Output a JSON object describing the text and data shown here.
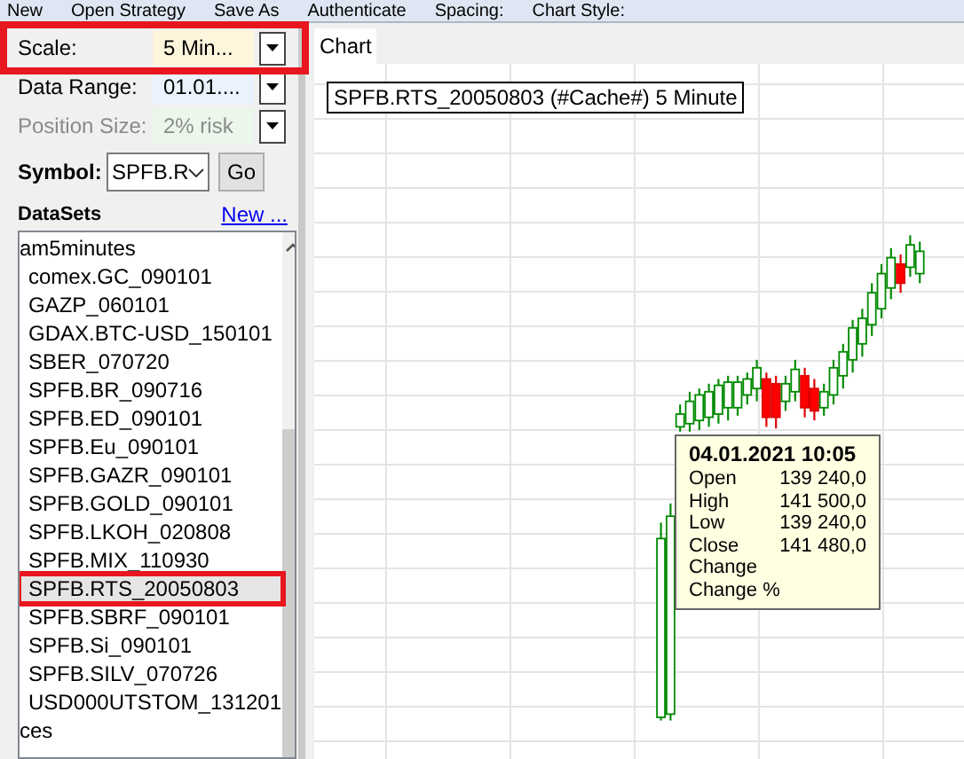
{
  "toolbar": [
    "New",
    "Open Strategy",
    "Save As",
    "Authenticate",
    "Spacing:",
    "Chart Style:"
  ],
  "settings": [
    {
      "label": "Scale:",
      "value": "5 Min...",
      "disabled": false,
      "highlighted": true,
      "color": "#fdf5dc"
    },
    {
      "label": "Data Range:",
      "value": "01.01....",
      "disabled": false,
      "highlighted": false,
      "color": "#eaf3fd"
    },
    {
      "label": "Position Size:",
      "value": "2% risk",
      "disabled": true,
      "highlighted": false,
      "color": "#eaf7ea"
    }
  ],
  "symbol": {
    "label": "Symbol:",
    "value": "SPFB.R",
    "button": "Go"
  },
  "datasets": {
    "title": "DataSets",
    "link": "New ...",
    "items": [
      {
        "label": "am5minutes",
        "selected": false,
        "highlighted": false
      },
      {
        "label": "comex.GC_090101",
        "selected": false,
        "highlighted": false
      },
      {
        "label": "GAZP_060101",
        "selected": false,
        "highlighted": false
      },
      {
        "label": "GDAX.BTC-USD_150101",
        "selected": false,
        "highlighted": false
      },
      {
        "label": "SBER_070720",
        "selected": false,
        "highlighted": false
      },
      {
        "label": "SPFB.BR_090716",
        "selected": false,
        "highlighted": false
      },
      {
        "label": "SPFB.ED_090101",
        "selected": false,
        "highlighted": false
      },
      {
        "label": "SPFB.Eu_090101",
        "selected": false,
        "highlighted": false
      },
      {
        "label": "SPFB.GAZR_090101",
        "selected": false,
        "highlighted": false
      },
      {
        "label": "SPFB.GOLD_090101",
        "selected": false,
        "highlighted": false
      },
      {
        "label": "SPFB.LKOH_020808",
        "selected": false,
        "highlighted": false
      },
      {
        "label": "SPFB.MIX_110930",
        "selected": false,
        "highlighted": false
      },
      {
        "label": "SPFB.RTS_20050803",
        "selected": true,
        "highlighted": true
      },
      {
        "label": "SPFB.SBRF_090101",
        "selected": false,
        "highlighted": false
      },
      {
        "label": "SPFB.Si_090101",
        "selected": false,
        "highlighted": false
      },
      {
        "label": "SPFB.SILV_070726",
        "selected": false,
        "highlighted": false
      },
      {
        "label": "USD000UTSTOM_131201",
        "selected": false,
        "highlighted": false
      },
      {
        "label": "ces",
        "selected": false,
        "highlighted": false
      }
    ]
  },
  "tabs": [
    {
      "label": "Chart",
      "selected": true
    }
  ],
  "chart": {
    "title": "SPFB.RTS_20050803 (#Cache#) 5 Minute",
    "tooltip": {
      "date": "04.01.2021 10:05",
      "rows": [
        {
          "label": "Open",
          "value": "139 240,0"
        },
        {
          "label": "High",
          "value": "141 500,0"
        },
        {
          "label": "Low",
          "value": "139 240,0"
        },
        {
          "label": "Close",
          "value": "141 480,0"
        },
        {
          "label": "Change"
        },
        {
          "label": "Change %"
        }
      ]
    }
  }
}
